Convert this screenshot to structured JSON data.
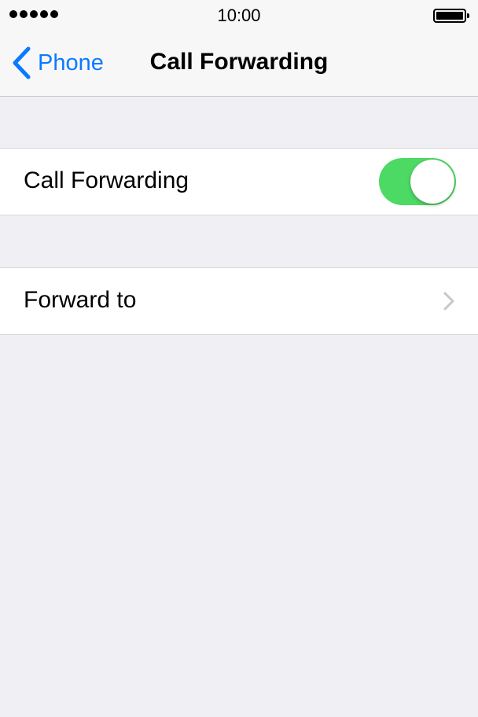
{
  "status_bar": {
    "signal_dots": 5,
    "time": "10:00",
    "battery_level": 1.0
  },
  "nav": {
    "back_label": "Phone",
    "title": "Call Forwarding"
  },
  "settings": {
    "call_forwarding_label": "Call Forwarding",
    "call_forwarding_on": true,
    "forward_to_label": "Forward to"
  },
  "colors": {
    "accent": "#0a7aff",
    "toggle_on": "#4cd964",
    "background": "#efeff4",
    "chevron": "#c7c7cc"
  },
  "icons": {
    "back": "chevron-left-icon",
    "disclosure": "chevron-right-icon",
    "battery": "battery-icon",
    "signal": "signal-dots-icon"
  }
}
